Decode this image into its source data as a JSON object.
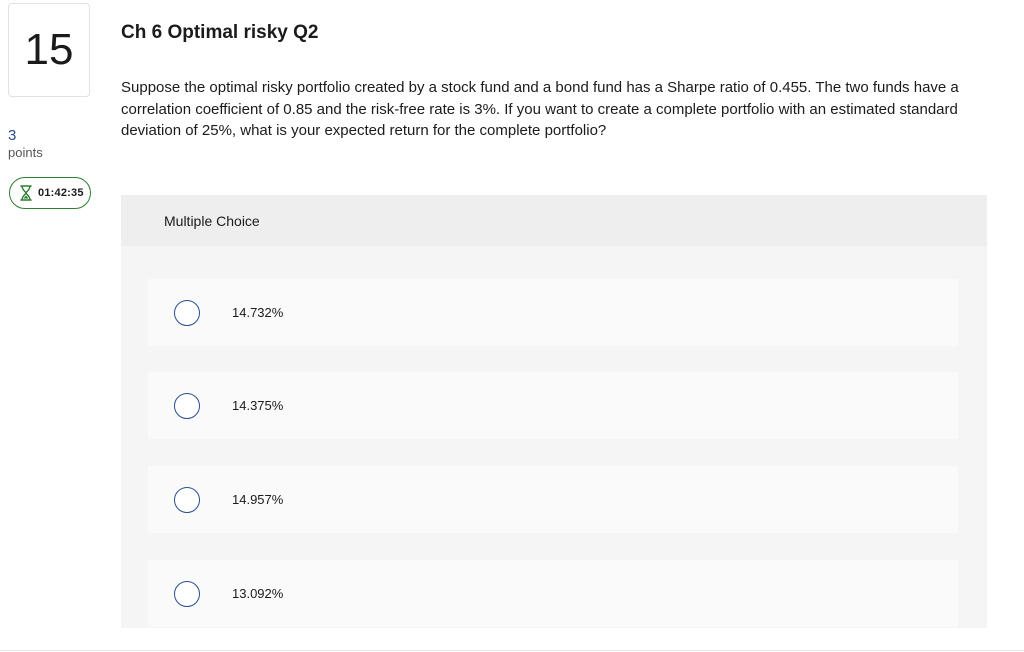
{
  "question": {
    "number": "15",
    "points_value": "3",
    "points_label": "points",
    "timer": "01:42:35",
    "title": "Ch 6 Optimal risky Q2",
    "text": "Suppose the optimal risky portfolio created by a stock fund and a bond fund  has a Sharpe ratio of 0.455. The two funds have a correlation coefficient of 0.85 and the risk-free rate is 3%. If you want to create a complete portfolio with an estimated standard deviation of 25%, what is your expected return for the complete portfolio?"
  },
  "multiple_choice": {
    "header": "Multiple Choice",
    "options": [
      {
        "label": "14.732%"
      },
      {
        "label": "14.375%"
      },
      {
        "label": "14.957%"
      },
      {
        "label": "13.092%"
      }
    ]
  },
  "colors": {
    "accent_blue": "#2a4d8f",
    "timer_green": "#2e7d32"
  },
  "icons": {
    "timer": "hourglass-icon",
    "choice": "radio-button-icon"
  }
}
